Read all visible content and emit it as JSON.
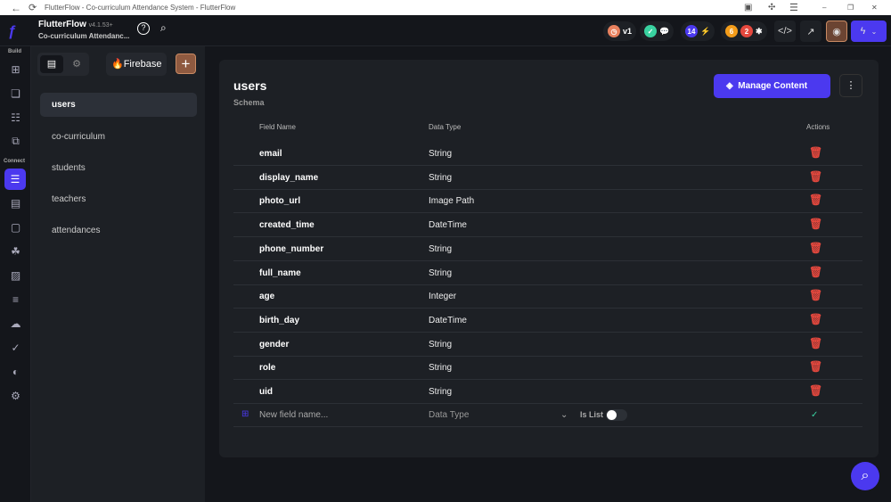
{
  "browser": {
    "title": "FlutterFlow - Co-curriculum Attendance System - FlutterFlow"
  },
  "app": {
    "name": "FlutterFlow",
    "version": "v4.1.53+",
    "project": "Co-curriculum Attendanc..."
  },
  "toolbar": {
    "version_label": "v1",
    "notifications_count": "14",
    "warnings_count": "6",
    "errors_count": "2"
  },
  "rail": {
    "build_label": "Build",
    "connect_label": "Connect"
  },
  "side": {
    "firebase_label": "Firebase",
    "collections": [
      "users",
      "co-curriculum",
      "students",
      "teachers",
      "attendances"
    ]
  },
  "collection": {
    "title": "users",
    "subtitle": "Schema",
    "manage_label": "Manage Content",
    "headers": {
      "field": "Field Name",
      "type": "Data Type",
      "actions": "Actions"
    },
    "fields": [
      {
        "name": "email",
        "type": "String"
      },
      {
        "name": "display_name",
        "type": "String"
      },
      {
        "name": "photo_url",
        "type": "Image Path"
      },
      {
        "name": "created_time",
        "type": "DateTime"
      },
      {
        "name": "phone_number",
        "type": "String"
      },
      {
        "name": "full_name",
        "type": "String"
      },
      {
        "name": "age",
        "type": "Integer"
      },
      {
        "name": "birth_day",
        "type": "DateTime"
      },
      {
        "name": "gender",
        "type": "String"
      },
      {
        "name": "role",
        "type": "String"
      },
      {
        "name": "uid",
        "type": "String"
      }
    ],
    "new_field": {
      "placeholder": "New field name...",
      "type_placeholder": "Data Type",
      "is_list_label": "Is List",
      "is_list": false
    }
  },
  "colors": {
    "accent": "#4b39ef",
    "danger": "#e5483e",
    "success": "#39d2a0"
  }
}
